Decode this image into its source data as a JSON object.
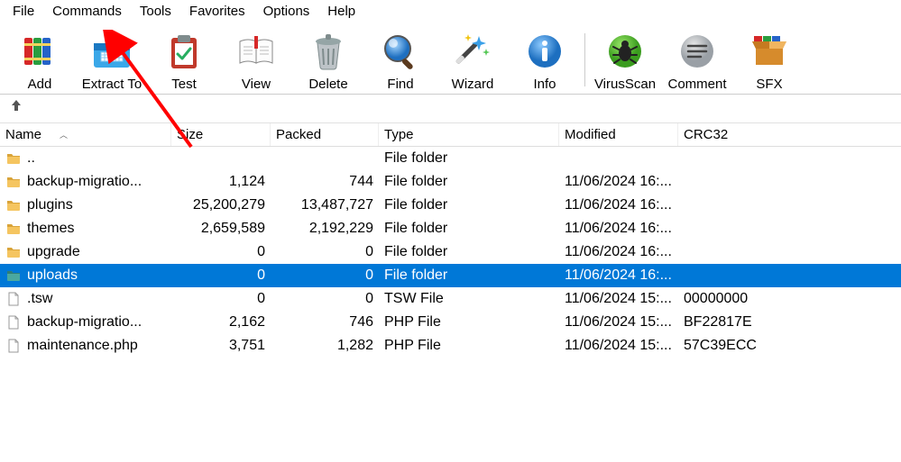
{
  "menu": {
    "items": [
      "File",
      "Commands",
      "Tools",
      "Favorites",
      "Options",
      "Help"
    ]
  },
  "toolbar": [
    {
      "label": "Add",
      "icon": "books"
    },
    {
      "label": "Extract To",
      "icon": "folder-out"
    },
    {
      "label": "Test",
      "icon": "clipboard-check"
    },
    {
      "label": "View",
      "icon": "open-book"
    },
    {
      "label": "Delete",
      "icon": "trash"
    },
    {
      "label": "Find",
      "icon": "magnifier"
    },
    {
      "label": "Wizard",
      "icon": "wand"
    },
    {
      "label": "Info",
      "icon": "info"
    },
    {
      "label": "VirusScan",
      "icon": "bug"
    },
    {
      "label": "Comment",
      "icon": "comment"
    },
    {
      "label": "SFX",
      "icon": "box"
    }
  ],
  "columns": [
    "Name",
    "Size",
    "Packed",
    "Type",
    "Modified",
    "CRC32"
  ],
  "table_rows": [
    {
      "icon": "folder",
      "name": "..",
      "size": "",
      "packed": "",
      "type": "File folder",
      "modified": "",
      "crc": ""
    },
    {
      "icon": "folder",
      "name": "backup-migratio...",
      "size": "1,124",
      "packed": "744",
      "type": "File folder",
      "modified": "11/06/2024 16:...",
      "crc": ""
    },
    {
      "icon": "folder",
      "name": "plugins",
      "size": "25,200,279",
      "packed": "13,487,727",
      "type": "File folder",
      "modified": "11/06/2024 16:...",
      "crc": ""
    },
    {
      "icon": "folder",
      "name": "themes",
      "size": "2,659,589",
      "packed": "2,192,229",
      "type": "File folder",
      "modified": "11/06/2024 16:...",
      "crc": ""
    },
    {
      "icon": "folder",
      "name": "upgrade",
      "size": "0",
      "packed": "0",
      "type": "File folder",
      "modified": "11/06/2024 16:...",
      "crc": ""
    },
    {
      "icon": "folder-sel",
      "name": "uploads",
      "size": "0",
      "packed": "0",
      "type": "File folder",
      "modified": "11/06/2024 16:...",
      "crc": "",
      "selected": true
    },
    {
      "icon": "file",
      "name": ".tsw",
      "size": "0",
      "packed": "0",
      "type": "TSW File",
      "modified": "11/06/2024 15:...",
      "crc": "00000000"
    },
    {
      "icon": "file",
      "name": "backup-migratio...",
      "size": "2,162",
      "packed": "746",
      "type": "PHP File",
      "modified": "11/06/2024 15:...",
      "crc": "BF22817E"
    },
    {
      "icon": "file",
      "name": "maintenance.php",
      "size": "3,751",
      "packed": "1,282",
      "type": "PHP File",
      "modified": "11/06/2024 15:...",
      "crc": "57C39ECC"
    }
  ]
}
